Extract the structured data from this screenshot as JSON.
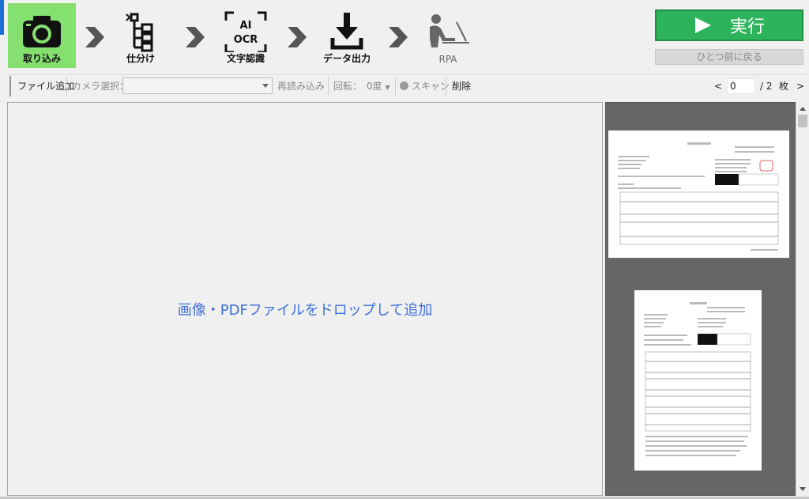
{
  "workflow": {
    "steps": [
      {
        "label": "取り込み",
        "icon": "camera-icon",
        "active": true
      },
      {
        "label": "仕分け",
        "icon": "sort-tree-icon",
        "active": false
      },
      {
        "label": "文字認識",
        "icon": "ai-ocr-icon",
        "active": false
      },
      {
        "label": "データ出力",
        "icon": "download-icon",
        "active": false
      },
      {
        "label": "RPA",
        "icon": "rpa-person-icon",
        "active": false
      }
    ],
    "run_label": "実行",
    "back_label": "ひとつ前に戻る"
  },
  "toolbar": {
    "add_file": "ファイル追加",
    "camera_label": "カメラ選択：",
    "camera_value": "",
    "reload": "再読み込み",
    "rotate_label": "回転：",
    "rotate_value": "0度",
    "scan": "スキャン",
    "delete": "削除"
  },
  "pager": {
    "prev": "<",
    "current": "0",
    "total": "/ 2",
    "unit": "枚",
    "next": ">"
  },
  "drop_area": {
    "hint": "画像・PDFファイルをドロップして追加"
  },
  "colors": {
    "active_step": "#86e06f",
    "run_button": "#2db35b",
    "drop_hint": "#3e6fd8",
    "preview_bg": "#666666"
  }
}
